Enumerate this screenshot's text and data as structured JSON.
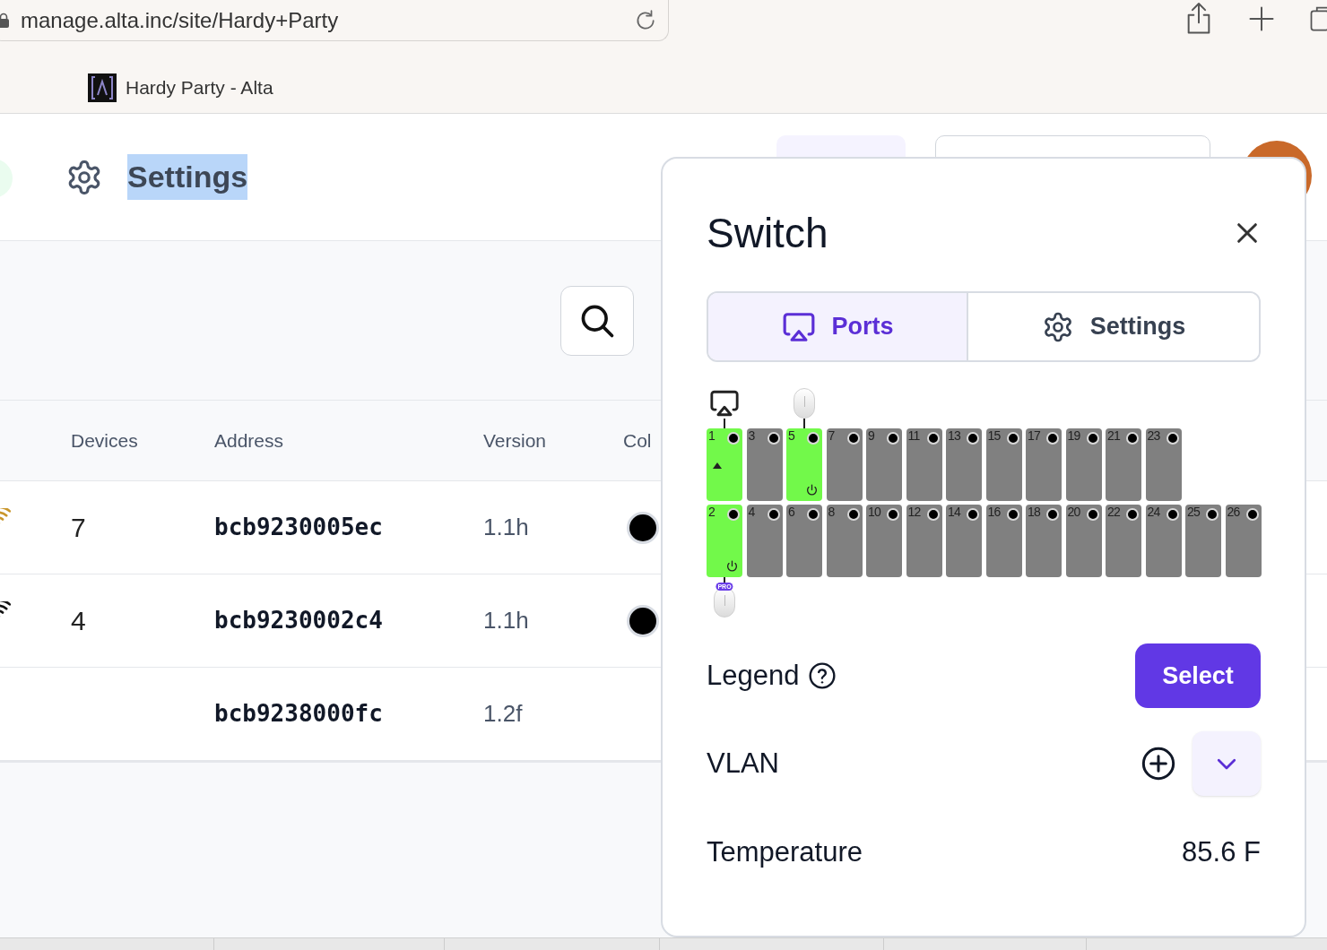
{
  "browser": {
    "url": "manage.alta.inc/site/Hardy+Party",
    "tab_title": "Hardy Party - Alta"
  },
  "page": {
    "title": "Settings"
  },
  "table": {
    "columns": [
      "Devices",
      "Address",
      "Version",
      "Col"
    ],
    "rows": [
      {
        "color": "#c9962b",
        "devices": "7",
        "address": "bcb9230005ec",
        "version": "1.1h",
        "status": true
      },
      {
        "color": "#111111",
        "devices": "4",
        "address": "bcb9230002c4",
        "version": "1.1h",
        "status": true
      },
      {
        "address": "bcb9238000fc",
        "version": "1.2f",
        "status": false
      }
    ]
  },
  "panel": {
    "title": "Switch",
    "tabs": [
      {
        "label": "Ports",
        "selected": true
      },
      {
        "label": "Settings",
        "selected": false
      }
    ],
    "port_rows": [
      [
        {
          "label": "1",
          "active": true,
          "kind": "uplink",
          "device": {
            "kind": "display"
          }
        },
        {
          "label": "3",
          "active": false,
          "kind": "plain"
        },
        {
          "label": "5",
          "active": true,
          "kind": "power",
          "device": {
            "kind": "pill"
          }
        },
        {
          "label": "7",
          "active": false,
          "kind": "plain"
        },
        {
          "label": "9",
          "active": false,
          "kind": "plain"
        },
        {
          "label": "11",
          "active": false,
          "kind": "plain"
        },
        {
          "label": "13",
          "active": false,
          "kind": "plain"
        },
        {
          "label": "15",
          "active": false,
          "kind": "plain"
        },
        {
          "label": "17",
          "active": false,
          "kind": "plain"
        },
        {
          "label": "19",
          "active": false,
          "kind": "plain"
        },
        {
          "label": "21",
          "active": false,
          "kind": "plain"
        },
        {
          "label": "23",
          "active": false,
          "kind": "plain"
        }
      ],
      [
        {
          "label": "2",
          "active": true,
          "kind": "power",
          "device": {
            "kind": "pill",
            "badge": "PRO"
          }
        },
        {
          "label": "4",
          "active": false,
          "kind": "plain"
        },
        {
          "label": "6",
          "active": false,
          "kind": "plain"
        },
        {
          "label": "8",
          "active": false,
          "kind": "plain"
        },
        {
          "label": "10",
          "active": false,
          "kind": "plain"
        },
        {
          "label": "12",
          "active": false,
          "kind": "plain"
        },
        {
          "label": "14",
          "active": false,
          "kind": "plain"
        },
        {
          "label": "16",
          "active": false,
          "kind": "plain"
        },
        {
          "label": "18",
          "active": false,
          "kind": "plain"
        },
        {
          "label": "20",
          "active": false,
          "kind": "plain"
        },
        {
          "label": "22",
          "active": false,
          "kind": "plain"
        },
        {
          "label": "24",
          "active": false,
          "kind": "plain"
        },
        {
          "label": "25",
          "active": false,
          "kind": "plain"
        },
        {
          "label": "26",
          "active": false,
          "kind": "plain"
        }
      ]
    ],
    "legend": "Legend",
    "select_button": "Select",
    "vlan": "VLAN",
    "temperature_label": "Temperature",
    "temperature_value": "85.6 F"
  }
}
